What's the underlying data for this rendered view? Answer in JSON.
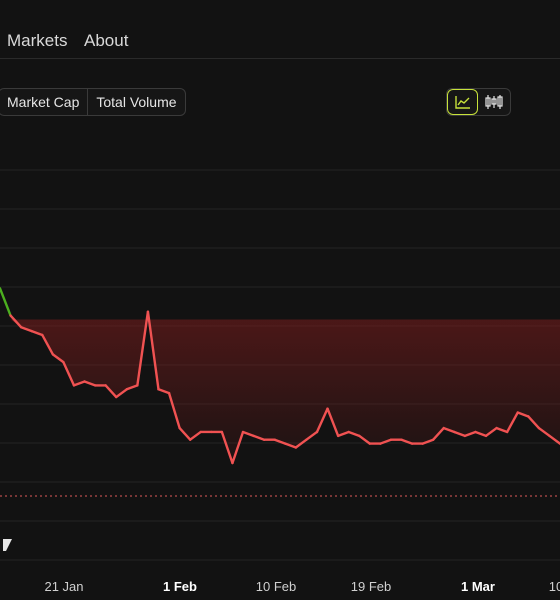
{
  "nav": {
    "items": [
      "Markets",
      "About"
    ]
  },
  "tabs": {
    "items": [
      "Market Cap",
      "Total Volume"
    ],
    "active": "Market Cap"
  },
  "view_toggle": {
    "options": [
      "line-chart-icon",
      "candlestick-chart-icon"
    ],
    "active": "line-chart-icon"
  },
  "colors": {
    "up": "#4caf1f",
    "down": "#f05252",
    "accent": "#c7e23a",
    "baseline": "#e05a5a"
  },
  "chart_data": {
    "type": "line",
    "x_tick_labels": [
      {
        "label": "21 Jan",
        "bold": false
      },
      {
        "label": "1 Feb",
        "bold": true
      },
      {
        "label": "10 Feb",
        "bold": false
      },
      {
        "label": "19 Feb",
        "bold": false
      },
      {
        "label": "1 Mar",
        "bold": true
      },
      {
        "label": "10",
        "bold": false
      }
    ],
    "y_range": [
      0,
      100
    ],
    "baseline": 62,
    "grid": true,
    "series": [
      {
        "values": [
          70,
          63,
          60,
          59,
          58,
          53,
          51,
          45,
          46,
          45,
          45,
          42,
          44,
          45,
          64,
          44,
          43,
          34,
          31,
          33,
          33,
          33,
          25,
          33,
          32,
          31,
          31,
          30,
          29,
          31,
          33,
          39,
          32,
          33,
          32,
          30,
          30,
          31,
          31,
          30,
          30,
          31,
          34,
          33,
          32,
          33,
          32,
          34,
          33,
          38,
          37,
          34,
          32,
          30
        ]
      }
    ]
  }
}
